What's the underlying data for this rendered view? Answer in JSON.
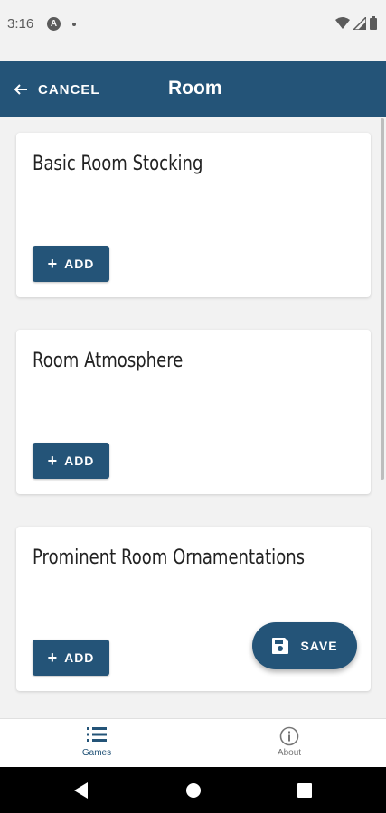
{
  "status_bar": {
    "time": "3:16",
    "icons": [
      "a-icon",
      "dot",
      "wifi-icon",
      "signal-icon",
      "battery-icon"
    ]
  },
  "app_bar": {
    "cancel_label": "CANCEL",
    "title": "Room",
    "background": "#245478"
  },
  "cards": [
    {
      "title": "Basic Room Stocking",
      "add_label": "ADD"
    },
    {
      "title": "Room Atmosphere",
      "add_label": "ADD"
    },
    {
      "title": "Prominent Room Ornamentations",
      "add_label": "ADD"
    }
  ],
  "fab": {
    "label": "SAVE",
    "icon": "save-icon"
  },
  "bottom_nav": {
    "items": [
      {
        "label": "Games",
        "icon": "list-icon",
        "active": true,
        "color": "#245478"
      },
      {
        "label": "About",
        "icon": "info-icon",
        "active": false,
        "color": "#757575"
      }
    ]
  },
  "system_nav": [
    "back",
    "home",
    "recents"
  ]
}
